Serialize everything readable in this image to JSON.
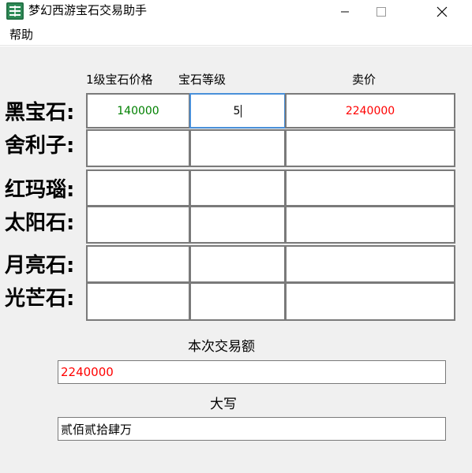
{
  "window": {
    "title": "梦幻西游宝石交易助手",
    "icon": "app-icon"
  },
  "menu": {
    "help_label": "帮助"
  },
  "columns": {
    "price_header": "1级宝石价格",
    "level_header": "宝石等级",
    "sell_header": "卖价"
  },
  "rows": [
    {
      "label": "黑宝石:",
      "price": "140000",
      "level": "5",
      "sell": "2240000"
    },
    {
      "label": "舍利子:",
      "price": "",
      "level": "",
      "sell": ""
    },
    {
      "label": "红玛瑙:",
      "price": "",
      "level": "",
      "sell": ""
    },
    {
      "label": "太阳石:",
      "price": "",
      "level": "",
      "sell": ""
    },
    {
      "label": "月亮石:",
      "price": "",
      "level": "",
      "sell": ""
    },
    {
      "label": "光芒石:",
      "price": "",
      "level": "",
      "sell": ""
    }
  ],
  "summary": {
    "amount_label": "本次交易额",
    "amount_value": "2240000",
    "capital_label": "大写",
    "capital_value": "贰佰贰拾肆万"
  },
  "colors": {
    "price_text": "#008000",
    "sell_text": "#ff0000",
    "focus_border": "#4a90d9",
    "background": "#f0f0f0"
  }
}
